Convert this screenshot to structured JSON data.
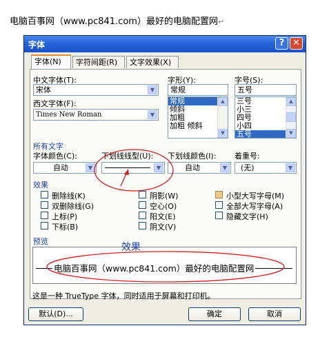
{
  "doc": {
    "line": "电脑百事网（www.pc841.com）最好的电脑配置网",
    "mark": "↵"
  },
  "dialog": {
    "title": "字体",
    "help_glyph": "?",
    "close_glyph": "✕",
    "tabs": [
      {
        "label": "字体(N)",
        "active": true
      },
      {
        "label": "字符间距(R)",
        "active": false
      },
      {
        "label": "文字效果(X)",
        "active": false
      }
    ],
    "chinese_font": {
      "label": "中文字体(T):",
      "value": "宋体"
    },
    "western_font": {
      "label": "西文字体(F):",
      "value": "Times New Roman"
    },
    "style": {
      "label": "字形(Y):",
      "value": "常规",
      "options": [
        "常规",
        "倾斜",
        "加粗",
        "加粗 倾斜"
      ],
      "selected": 0
    },
    "size": {
      "label": "字号(S):",
      "value": "五号",
      "options": [
        "三号",
        "小三",
        "四号",
        "小四",
        "五号"
      ],
      "selected": 4
    },
    "all_text": {
      "heading": "所有文字",
      "font_color": {
        "label": "字体颜色(C):",
        "value": "自动"
      },
      "underline_style": {
        "label": "下划线线型(U):"
      },
      "underline_color": {
        "label": "下划线颜色(I):",
        "value": "自动"
      },
      "emphasis": {
        "label": "着重号:",
        "value": "(无)"
      }
    },
    "effects": {
      "heading": "效果",
      "col1": [
        "删除线(K)",
        "双删除线(G)",
        "上标(P)",
        "下标(B)"
      ],
      "col2": [
        "阴影(W)",
        "空心(O)",
        "阳文(E)",
        "阴文(V)"
      ],
      "col3": [
        "小型大写字母(M)",
        "全部大写字母(A)",
        "隐藏文字(H)"
      ]
    },
    "preview": {
      "heading": "预览",
      "text": "电脑百事网（www.pc841.com）最好的电脑配置网"
    },
    "truetype_note": "这是一种 TrueType 字体，同时适用于屏幕和打印机。",
    "buttons": {
      "default": "默认(D)...",
      "ok": "确定",
      "cancel": "取消"
    }
  },
  "annotation": {
    "effect_label": "效果"
  },
  "colors": {
    "title_bar": "#2563d9",
    "annotation": "#d21c1c",
    "selection": "#316ac5"
  }
}
